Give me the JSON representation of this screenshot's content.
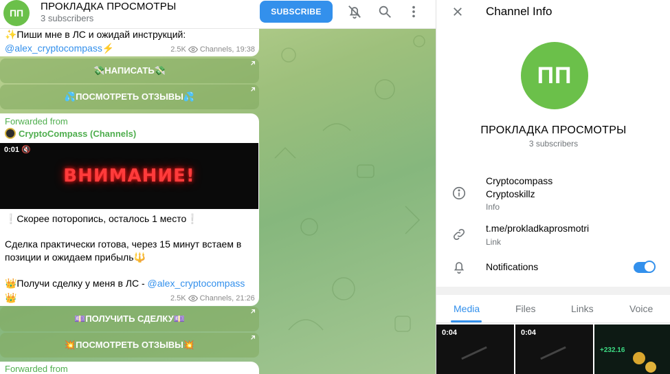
{
  "header": {
    "avatar_initials": "ПП",
    "title": "ПРОКЛАДКА ПРОСМОТРЫ",
    "subtitle": "3 subscribers",
    "subscribe_label": "SUBSCRIBE",
    "icons": [
      "bell-off-icon",
      "search-icon",
      "more-vertical-icon"
    ]
  },
  "messages": {
    "first": {
      "text_line1": "✨Пиши мне в ЛС и ожидай инструкций:",
      "mention": "@alex_cryptocompass",
      "mention_suffix": "⚡",
      "views": "2.5K",
      "channel_time": "Channels, 19:38",
      "buttons": [
        "💸НАПИСАТЬ💸",
        "💦ПОСМОТРЕТЬ ОТЗЫВЫ💦"
      ]
    },
    "second": {
      "forwarded_label": "Forwarded from",
      "forwarded_source": "CryptoCompass (Channels)",
      "video_time": "0:01",
      "video_text": "ВНИМАНИЕ!",
      "line1": "❕Скорее поторопись, осталось 1 место❕",
      "line2": "Сделка практически готова, через 15 минут встаем в позиции и ожидаем прибыль🔱",
      "line3_prefix": "👑Получи сделку у меня в ЛС - ",
      "mention": "@alex_cryptocompass",
      "line4": "👑",
      "views": "2.5K",
      "channel_time": "Channels, 21:26",
      "buttons": [
        "💷ПОЛУЧИТЬ СДЕЛКУ💷",
        "💥ПОСМОТРЕТЬ ОТЗЫВЫ💥"
      ]
    },
    "third": {
      "forwarded_label": "Forwarded from"
    }
  },
  "panel": {
    "title": "Channel Info",
    "avatar_initials": "ПП",
    "channel_name": "ПРОКЛАДКА ПРОСМОТРЫ",
    "subscribers": "3 subscribers",
    "info_line1": "Cryptocompass",
    "info_line2": "Cryptoskillz",
    "info_label": "Info",
    "link": "t.me/prokladkaprosmotri",
    "link_label": "Link",
    "notifications_label": "Notifications",
    "notifications_on": true,
    "tabs": [
      "Media",
      "Files",
      "Links",
      "Voice"
    ],
    "active_tab": "Media",
    "media": [
      {
        "time": "0:04"
      },
      {
        "time": "0:04"
      },
      {
        "time": "",
        "caption": "+232.16"
      }
    ]
  },
  "colors": {
    "accent": "#3390ec",
    "avatar": "#6bc04a",
    "forward": "#4fae4e"
  }
}
